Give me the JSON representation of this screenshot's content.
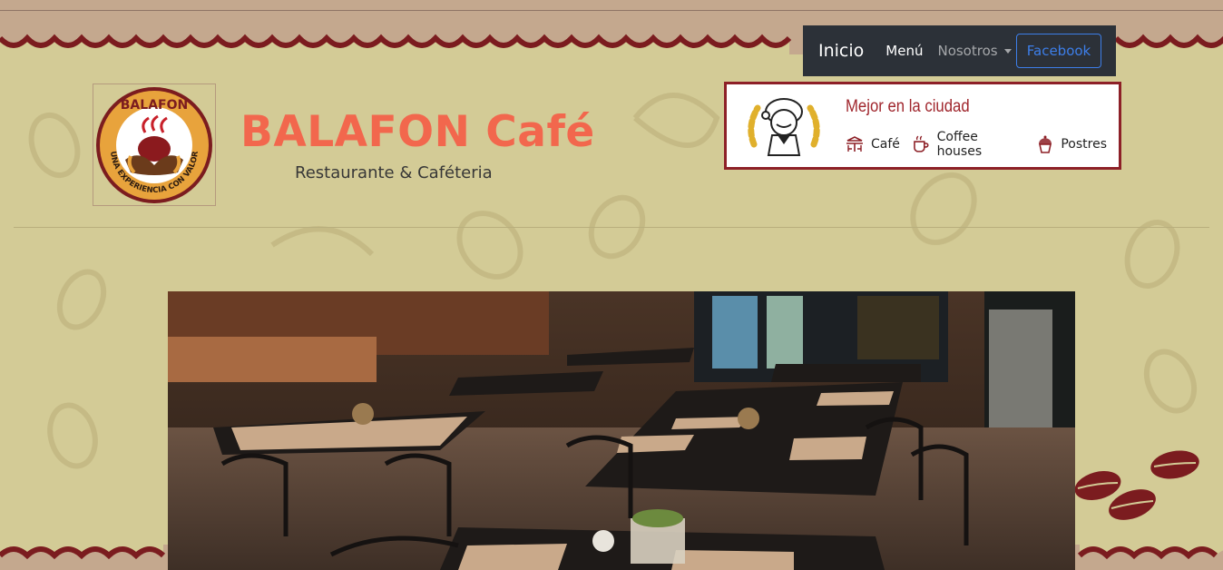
{
  "navbar": {
    "brand": "Inicio",
    "links": [
      {
        "label": "Menú"
      },
      {
        "label": "Nosotros"
      }
    ],
    "facebook_label": "Facebook"
  },
  "header": {
    "title": "BALAFON Café",
    "subtitle": "Restaurante & Caféteria",
    "logo_text_top": "BALAFON",
    "logo_text_bottom": "UNA EXPERIENCIA CON VALOR"
  },
  "badge": {
    "title": "Mejor en la ciudad",
    "tags": [
      {
        "label": "Café",
        "icon": "cafe-table-icon"
      },
      {
        "label": "Coffee houses",
        "icon": "coffee-cup-icon"
      },
      {
        "label": "Postres",
        "icon": "cupcake-icon"
      }
    ]
  },
  "hero": {
    "image": "restaurant-interior-photo"
  },
  "colors": {
    "background": "#d3cb96",
    "title": "#f2674d",
    "navbar": "#2c3138",
    "badge_border": "#8d2027",
    "link_blue": "#3d7ee8"
  }
}
